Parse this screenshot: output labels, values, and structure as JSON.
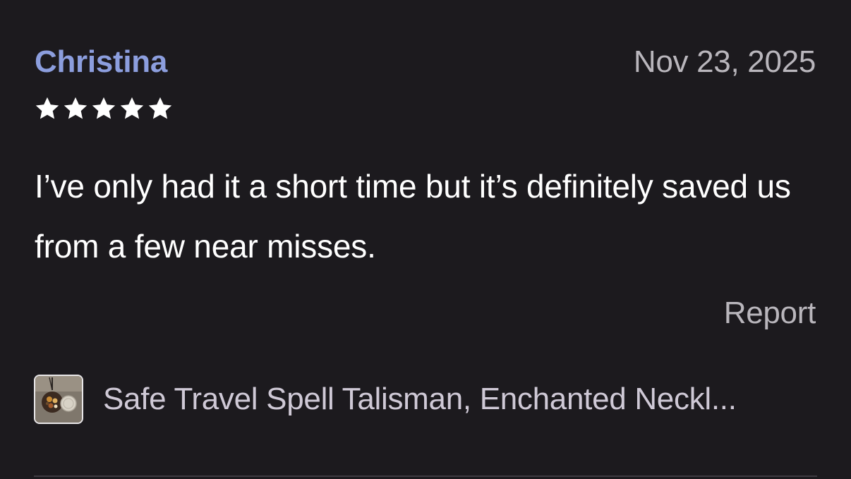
{
  "review": {
    "reviewer_name": "Christina",
    "date": "Nov 23, 2025",
    "rating": 5,
    "rating_max": 5,
    "text": "I’ve only had it a short time but it’s definitely saved us from a few near misses.",
    "report_label": "Report"
  },
  "product": {
    "title": "Safe Travel Spell Talisman, Enchanted Neckl...",
    "thumbnail_icon": "product-thumbnail-image"
  },
  "colors": {
    "background": "#1c1a1e",
    "reviewer_name": "#8c9ede",
    "secondary_text": "#b9b6bc",
    "body_text": "#ffffff",
    "star": "#ffffff"
  }
}
